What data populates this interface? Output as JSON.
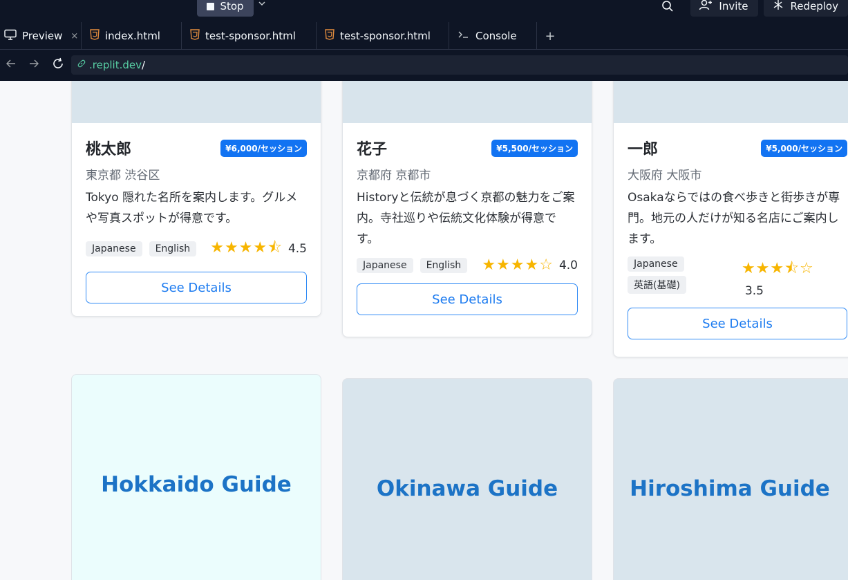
{
  "toolbar": {
    "stop_label": "Stop",
    "invite_label": "Invite",
    "redeploy_label": "Redeploy"
  },
  "tabs": [
    {
      "label": "Preview",
      "icon": "monitor-icon",
      "close": "×"
    },
    {
      "label": "index.html",
      "icon": "html5-icon"
    },
    {
      "label": "test-sponsor.html",
      "icon": "html5-icon"
    },
    {
      "label": "test-sponsor.html",
      "icon": "html5-icon"
    },
    {
      "label": "Console",
      "icon": "terminal-icon"
    }
  ],
  "tab_add": "+",
  "url": {
    "host": ".replit.dev",
    "path": "/"
  },
  "guides": [
    {
      "name": "桃太郎",
      "price": "¥6,000/セッション",
      "location": "東京都 渋谷区",
      "description": "Tokyo 隠れた名所を案内します。グルメや写真スポットが得意です。",
      "languages": [
        "Japanese",
        "English"
      ],
      "stars": "★★★★⯪",
      "rating": "4.5",
      "rating_value": 4.5,
      "button": "See Details"
    },
    {
      "name": "花子",
      "price": "¥5,500/セッション",
      "location": "京都府 京都市",
      "description": "Historyと伝統が息づく京都の魅力をご案内。寺社巡りや伝統文化体験が得意です。",
      "languages": [
        "Japanese",
        "English"
      ],
      "stars": "★★★★☆",
      "rating": "4.0",
      "rating_value": 4.0,
      "button": "See Details"
    },
    {
      "name": "一郎",
      "price": "¥5,000/セッション",
      "location": "大阪府 大阪市",
      "description": "Osakaならではの食べ歩きと街歩きが専門。地元の人だけが知る名店にご案内します。",
      "languages": [
        "Japanese",
        "英語(基礎)"
      ],
      "stars": "★★★⯪☆",
      "rating": "3.5",
      "rating_value": 3.5,
      "button": "See Details"
    }
  ],
  "promos": [
    {
      "title": "Hokkaido Guide",
      "bg": "#ebfdfd"
    },
    {
      "title": "Okinawa Guide",
      "bg": "#d9e5ed"
    },
    {
      "title": "Hiroshima Guide",
      "bg": "#d9e5ed"
    }
  ],
  "colors": {
    "accent": "#1273f2",
    "star": "#f7b500",
    "chrome": "#0e1525"
  }
}
